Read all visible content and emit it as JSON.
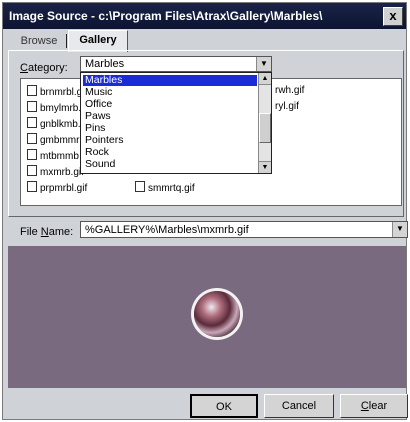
{
  "window": {
    "title": "Image Source - c:\\Program Files\\Atrax\\Gallery\\Marbles\\",
    "close_label": "x"
  },
  "tabs": [
    {
      "label": "Browse"
    },
    {
      "label": "Gallery"
    }
  ],
  "category": {
    "label_underline": "C",
    "label_rest": "ategory:",
    "value": "Marbles",
    "options": [
      "Marbles",
      "Music",
      "Office",
      "Paws",
      "Pins",
      "Pointers",
      "Rock",
      "Sound"
    ]
  },
  "files": {
    "col1": [
      "brnmrbl.gif",
      "bmylmrb.gif",
      "gnblkmb.gif",
      "gmbmmr",
      "mtbmmb",
      "mxmrb.gif",
      "prpmrbl.gif"
    ],
    "col2": [
      "smmrtq.gif"
    ],
    "col3": [
      "rwh.gif",
      "ryl.gif"
    ]
  },
  "file_name": {
    "label_before": "File ",
    "label_underline": "N",
    "label_after": "ame:",
    "value": "%GALLERY%\\Marbles\\mxmrb.gif"
  },
  "buttons": {
    "ok": "OK",
    "cancel": "Cancel",
    "clear_underline": "C",
    "clear_rest": "lear"
  }
}
